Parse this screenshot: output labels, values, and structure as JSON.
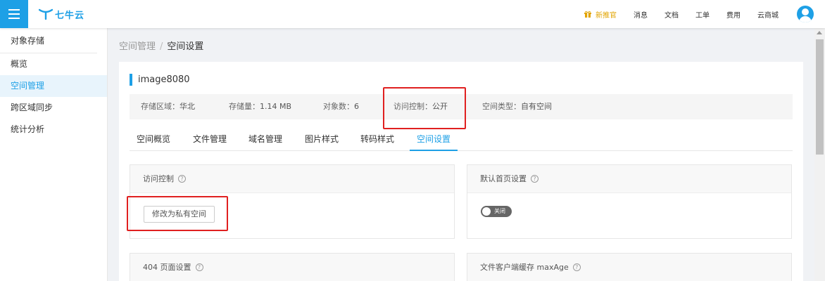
{
  "header": {
    "logo_text": "七牛云",
    "nav": [
      "新推官",
      "消息",
      "文档",
      "工单",
      "费用",
      "云商城"
    ]
  },
  "sidebar": {
    "title": "对象存储",
    "items": [
      {
        "label": "概览",
        "active": false
      },
      {
        "label": "空间管理",
        "active": true
      },
      {
        "label": "跨区域同步",
        "active": false
      },
      {
        "label": "统计分析",
        "active": false
      }
    ]
  },
  "breadcrumb": {
    "parent": "空间管理",
    "separator": "/",
    "current": "空间设置"
  },
  "bucket": {
    "name": "image8080",
    "region_label": "存储区域：",
    "region": "华北",
    "storage_label": "存储量：",
    "storage": "1.14 MB",
    "objects_label": "对象数：",
    "objects": "6",
    "access_label": "访问控制：",
    "access": "公开",
    "type_label": "空间类型：",
    "type": "自有空间"
  },
  "tabs": [
    {
      "label": "空间概览",
      "active": false
    },
    {
      "label": "文件管理",
      "active": false
    },
    {
      "label": "域名管理",
      "active": false
    },
    {
      "label": "图片样式",
      "active": false
    },
    {
      "label": "转码样式",
      "active": false
    },
    {
      "label": "空间设置",
      "active": true
    }
  ],
  "cards": {
    "access_control": {
      "title": "访问控制",
      "button": "修改为私有空间"
    },
    "default_index": {
      "title": "默认首页设置",
      "toggle_label": "关闭",
      "toggle_on": false
    },
    "page_404": {
      "title": "404 页面设置"
    },
    "max_age": {
      "title": "文件客户端缓存 maxAge"
    }
  },
  "colors": {
    "brand": "#1ea0e6",
    "highlight": "#e02020",
    "promo": "#e2a400"
  }
}
